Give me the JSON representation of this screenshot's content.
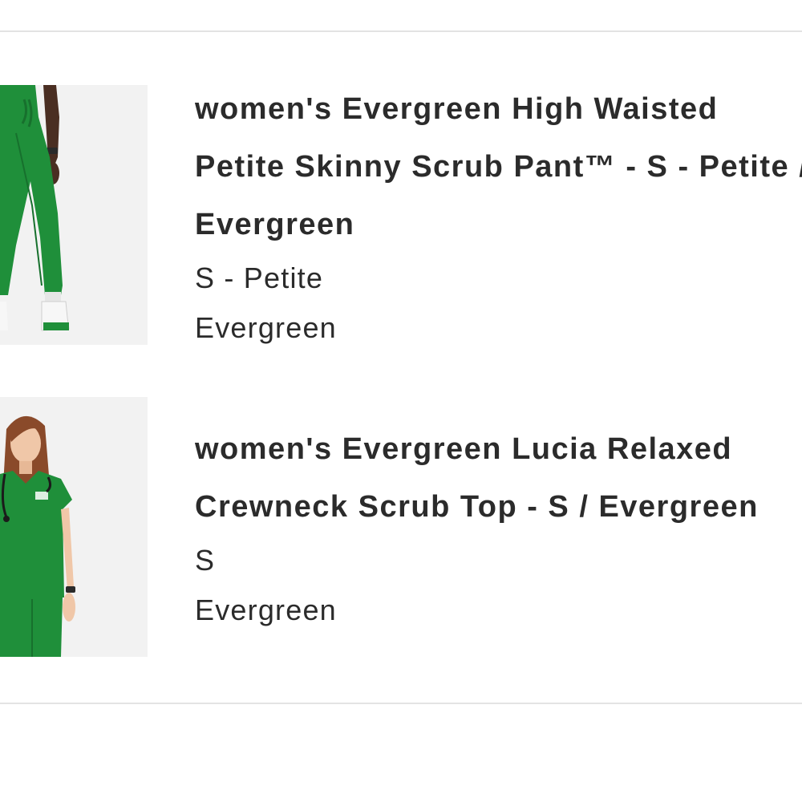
{
  "cart_items": [
    {
      "title_lines": [
        "women's Evergreen High Waisted",
        "Petite Skinny Scrub Pant™ - S - Petite /",
        "Evergreen"
      ],
      "size": "S - Petite",
      "color": "Evergreen",
      "image_icon": "scrub-pant-product-image"
    },
    {
      "title_lines": [
        "women's Evergreen Lucia Relaxed",
        "Crewneck Scrub Top - S / Evergreen"
      ],
      "size": "S",
      "color": "Evergreen",
      "image_icon": "scrub-top-product-image"
    }
  ],
  "colors": {
    "scrub_green": "#1f8f3a",
    "text": "#2b2b2b",
    "divider": "#e3e3e3",
    "image_bg": "#f2f2f2"
  }
}
